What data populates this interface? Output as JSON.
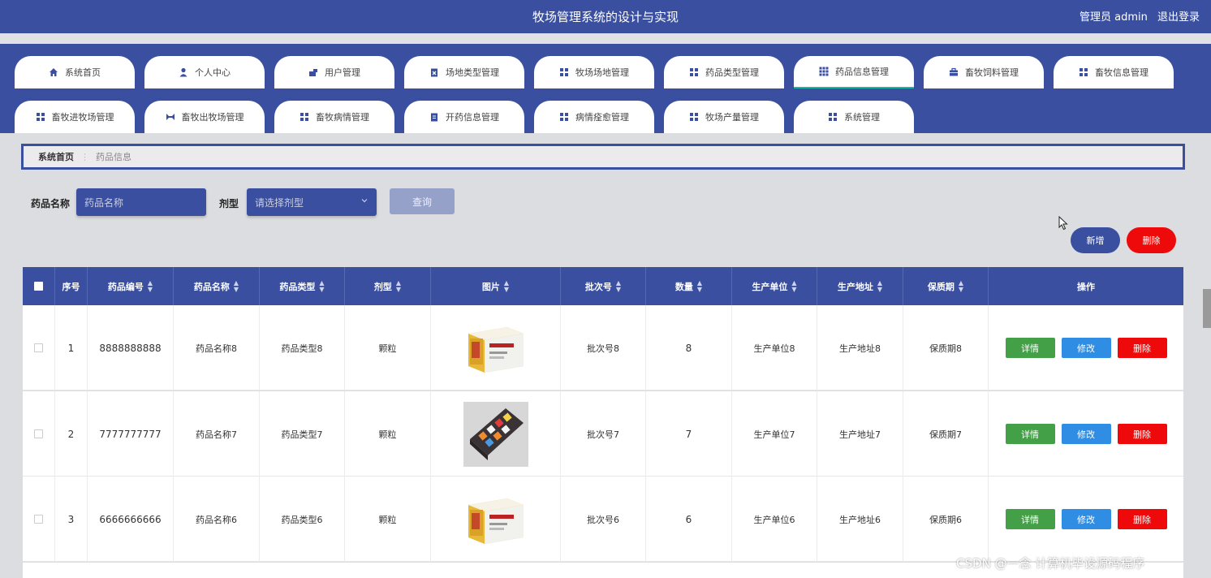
{
  "header": {
    "title": "牧场管理系统的设计与实现",
    "user_label": "管理员 admin",
    "logout_label": "退出登录"
  },
  "nav": {
    "tabs": [
      {
        "label": "系统首页",
        "icon": "home-icon"
      },
      {
        "label": "个人中心",
        "icon": "user-icon"
      },
      {
        "label": "用户管理",
        "icon": "users-icon"
      },
      {
        "label": "场地类型管理",
        "icon": "clipboard-x-icon"
      },
      {
        "label": "牧场场地管理",
        "icon": "grid-icon"
      },
      {
        "label": "药品类型管理",
        "icon": "grid-icon"
      },
      {
        "label": "药品信息管理",
        "icon": "grid9-icon"
      },
      {
        "label": "畜牧饲料管理",
        "icon": "briefcase-icon"
      },
      {
        "label": "畜牧信息管理",
        "icon": "grid-icon"
      },
      {
        "label": "畜牧进牧场管理",
        "icon": "grid-icon"
      },
      {
        "label": "畜牧出牧场管理",
        "icon": "shuffle-icon"
      },
      {
        "label": "畜牧病情管理",
        "icon": "grid-icon"
      },
      {
        "label": "开药信息管理",
        "icon": "clipboard-icon"
      },
      {
        "label": "病情痊愈管理",
        "icon": "grid-icon"
      },
      {
        "label": "牧场产量管理",
        "icon": "grid-icon"
      },
      {
        "label": "系统管理",
        "icon": "grid-icon"
      }
    ],
    "active_index": 6
  },
  "breadcrumb": {
    "home": "系统首页",
    "separator": "⋮",
    "current": "药品信息"
  },
  "search": {
    "name_label": "药品名称",
    "name_placeholder": "药品名称",
    "type_label": "剂型",
    "type_placeholder": "请选择剂型",
    "query_button": "查询"
  },
  "actions": {
    "add_label": "新增",
    "delete_label": "删除"
  },
  "table": {
    "columns": [
      "序号",
      "药品编号",
      "药品名称",
      "药品类型",
      "剂型",
      "图片",
      "批次号",
      "数量",
      "生产单位",
      "生产地址",
      "保质期",
      "操作"
    ],
    "rows": [
      {
        "index": "1",
        "code": "8888888888",
        "name": "药品名称8",
        "type": "药品类型8",
        "form": "颗粒",
        "image": "medicine-box",
        "batch": "批次号8",
        "qty": "8",
        "maker": "生产单位8",
        "address": "生产地址8",
        "shelf": "保质期8"
      },
      {
        "index": "2",
        "code": "7777777777",
        "name": "药品名称7",
        "type": "药品类型7",
        "form": "颗粒",
        "image": "pill-organizer",
        "batch": "批次号7",
        "qty": "7",
        "maker": "生产单位7",
        "address": "生产地址7",
        "shelf": "保质期7"
      },
      {
        "index": "3",
        "code": "6666666666",
        "name": "药品名称6",
        "type": "药品类型6",
        "form": "颗粒",
        "image": "medicine-box",
        "batch": "批次号6",
        "qty": "6",
        "maker": "生产单位6",
        "address": "生产地址6",
        "shelf": "保质期6"
      }
    ],
    "row_actions": {
      "detail": "详情",
      "edit": "修改",
      "delete": "删除"
    }
  },
  "watermark": "CSDN @一念 计算机毕设源码程序",
  "colors": {
    "primary": "#3a4f9f",
    "detail_button": "#43a047",
    "edit_button": "#2f8de4",
    "delete_button": "#ee0a0a"
  }
}
